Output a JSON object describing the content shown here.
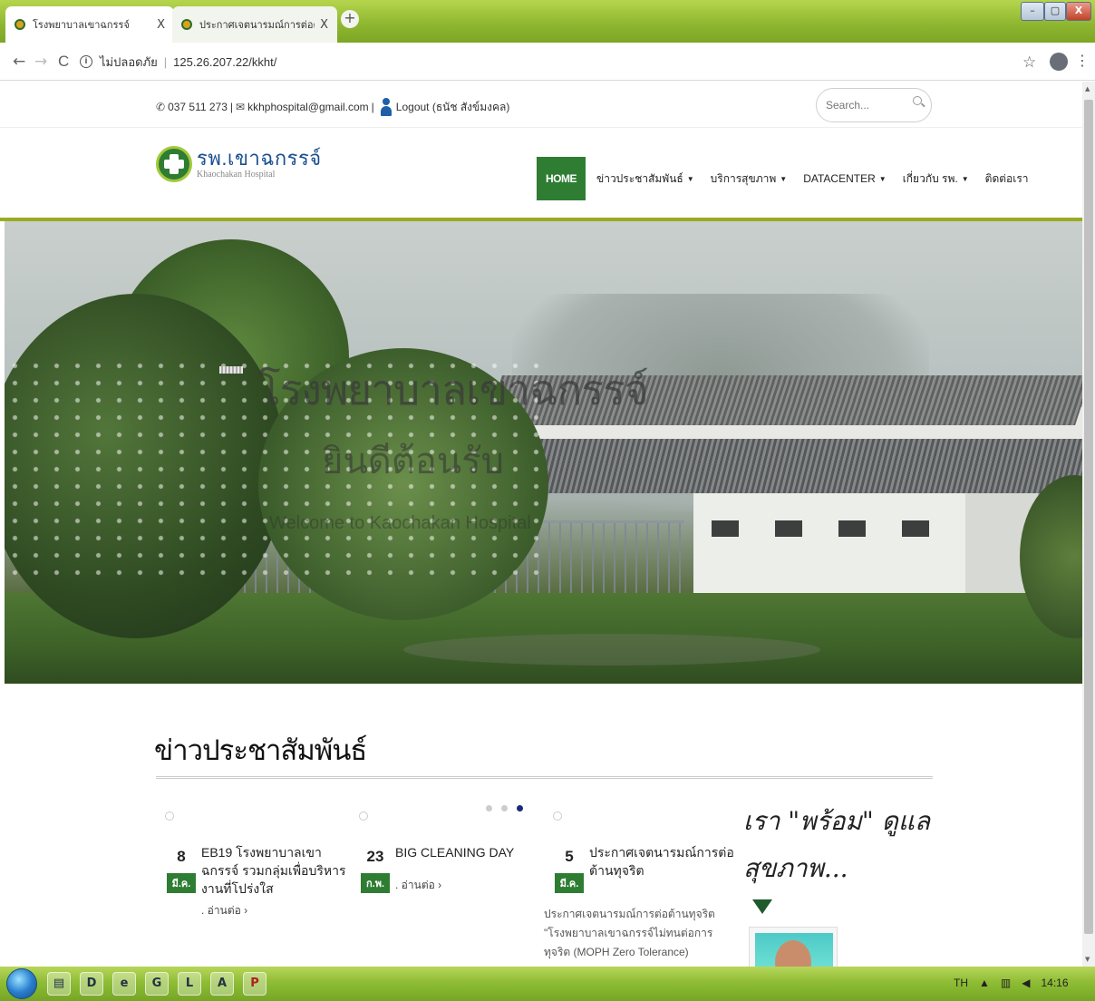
{
  "browser": {
    "tabs": [
      {
        "title": "โรงพยาบาลเขาฉกรรจ์",
        "active": true
      },
      {
        "title": "ประกาศเจตนารมณ์การต่อต้านทุจริต",
        "active": false
      }
    ],
    "tab_close_glyph": "X",
    "new_tab_glyph": "+",
    "window_controls": {
      "minimize": "–",
      "maximize": "▢",
      "close": "X"
    },
    "nav": {
      "back": "←",
      "forward": "→",
      "reload": "C"
    },
    "url_security_label": "ไม่ปลอดภัย",
    "url_separator": "|",
    "url": "125.26.207.22/kkht/",
    "info_glyph": "i",
    "bookmark_glyph": "☆",
    "menu_glyph": "⋮"
  },
  "site": {
    "topbar": {
      "phone": "037 511 273",
      "separator": "|",
      "email": "kkhphospital@gmail.com",
      "logout": "Logout (ธนัช สังข์มงคล)",
      "phone_icon": "phone-icon",
      "mail_icon": "mail-icon",
      "search_placeholder": "Search..."
    },
    "logo": {
      "name_th": "รพ.เขาฉกรรจ์",
      "name_en": "Khaochakan Hospital"
    },
    "nav": [
      {
        "label": "HOME",
        "dropdown": false,
        "active": true
      },
      {
        "label": "ข่าวประชาสัมพันธ์",
        "dropdown": true
      },
      {
        "label": "บริการสุขภาพ",
        "dropdown": true
      },
      {
        "label": "DATACENTER",
        "dropdown": true
      },
      {
        "label": "เกี่ยวกับ รพ.",
        "dropdown": true
      },
      {
        "label": "ติดต่อเรา",
        "dropdown": false
      }
    ],
    "dropdown_caret": "▼",
    "hero": {
      "title": "โรงพยาบาลเขาฉกรรจ์",
      "subtitle_th": "ยินดีต้อนรับ",
      "subtitle_en": "Welcome to Kaochakan Hospital"
    },
    "news": {
      "heading": "ข่าวประชาสัมพันธ์",
      "carousel_pages": 3,
      "carousel_active_index": 2,
      "items": [
        {
          "day": "8",
          "month": "มี.ค.",
          "title": "EB19 โรงพยาบาลเขาฉกรรจ์ รวมกลุ่มเพื่อบริหารงานที่โปร่งใส",
          "read_more": ". อ่านต่อ ›",
          "excerpt": ""
        },
        {
          "day": "23",
          "month": "ก.พ.",
          "title": "BIG CLEANING DAY",
          "read_more": ". อ่านต่อ ›",
          "excerpt": ""
        },
        {
          "day": "5",
          "month": "มี.ค.",
          "title": "ประกาศเจตนารมณ์การต่อต้านทุจริต",
          "read_more": "",
          "excerpt": "ประกาศเจตนารมณ์การต่อต้านทุจริต \"โรงพยาบาลเขาฉกรรจ์ไม่ทนต่อการทุจริต (MOPH Zero Tolerance) ประสา"
        }
      ]
    },
    "side_banner": {
      "line1": "เรา \"พร้อม\" ดูแล",
      "line2": "สุขภาพ..."
    }
  },
  "taskbar": {
    "apps": [
      "D",
      "e",
      "G",
      "L",
      "A",
      "P"
    ],
    "language": "TH",
    "tray_up": "▲",
    "clock": "14:16"
  },
  "colors": {
    "accent_green": "#2e7d32",
    "rule_olive": "#9aab22",
    "taskbar_green": "#8fbd35"
  }
}
